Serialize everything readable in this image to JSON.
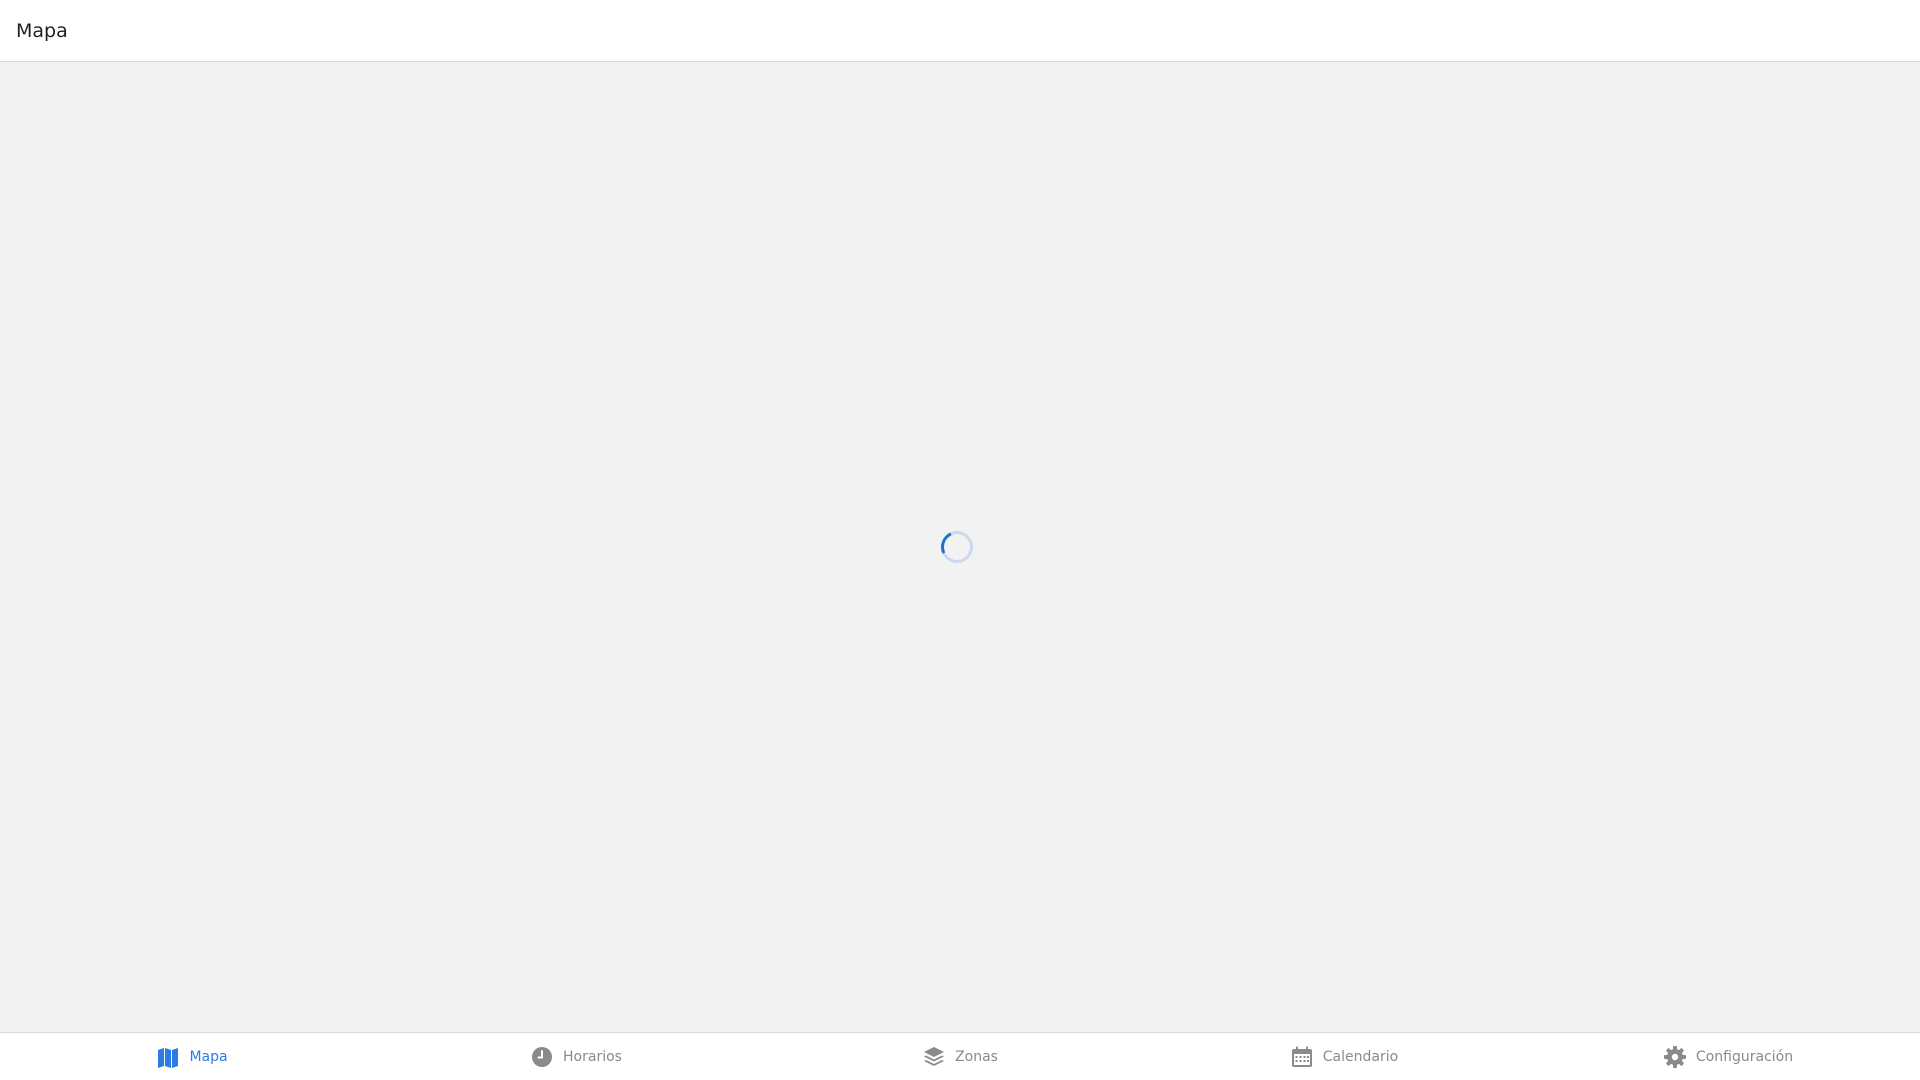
{
  "header": {
    "title": "Mapa"
  },
  "loader": {
    "icon": "loading-spinner"
  },
  "colors": {
    "accent": "#2a7be4",
    "inactive": "#8a8a8a",
    "background": "#f2f2f2"
  },
  "tabs": [
    {
      "label": "Mapa",
      "icon": "map-icon",
      "active": true
    },
    {
      "label": "Horarios",
      "icon": "clock-icon",
      "active": false
    },
    {
      "label": "Zonas",
      "icon": "layers-icon",
      "active": false
    },
    {
      "label": "Calendario",
      "icon": "calendar-icon",
      "active": false
    },
    {
      "label": "Configuración",
      "icon": "gear-icon",
      "active": false
    }
  ]
}
